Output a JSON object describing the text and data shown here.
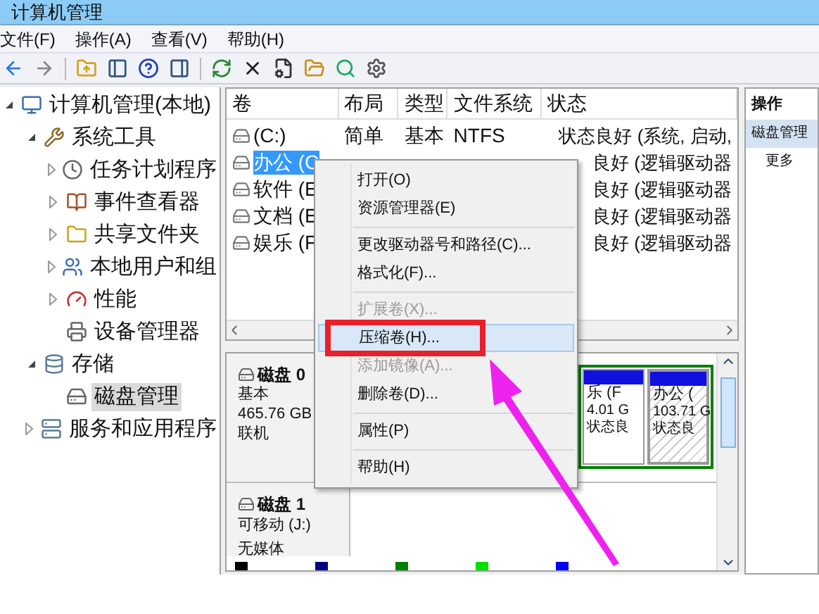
{
  "window": {
    "title": "计算机管理"
  },
  "menu_bar": [
    "文件(F)",
    "操作(A)",
    "查看(V)",
    "帮助(H)"
  ],
  "tree": [
    {
      "label": "计算机管理(本地)",
      "expanded": true,
      "selected": false,
      "children": [
        {
          "label": "系统工具",
          "expanded": true,
          "selected": false,
          "children": [
            {
              "label": "任务计划程序",
              "expanded": false,
              "selected": false
            },
            {
              "label": "事件查看器",
              "expanded": false,
              "selected": false
            },
            {
              "label": "共享文件夹",
              "expanded": false,
              "selected": false
            },
            {
              "label": "本地用户和组",
              "expanded": false,
              "selected": false
            },
            {
              "label": "性能",
              "expanded": false,
              "selected": false
            },
            {
              "label": "设备管理器",
              "selected": false
            }
          ]
        },
        {
          "label": "存储",
          "expanded": true,
          "selected": false,
          "children": [
            {
              "label": "磁盘管理",
              "selected": true
            }
          ]
        },
        {
          "label": "服务和应用程序",
          "expanded": false,
          "selected": false
        }
      ]
    }
  ],
  "volumes": {
    "columns": [
      "卷",
      "布局",
      "类型",
      "文件系统",
      "状态"
    ],
    "rows": [
      {
        "cells": [
          "(C:)",
          "简单",
          "基本",
          "NTFS",
          "状态良好 (系统, 启动,"
        ],
        "selected": false
      },
      {
        "cells": [
          "办公 (C",
          "",
          "",
          "",
          "良好 (逻辑驱动器"
        ],
        "selected": true
      },
      {
        "cells": [
          "软件 (E",
          "",
          "",
          "",
          "良好 (逻辑驱动器"
        ],
        "selected": false
      },
      {
        "cells": [
          "文档 (E",
          "",
          "",
          "",
          "良好 (逻辑驱动器"
        ],
        "selected": false
      },
      {
        "cells": [
          "娱乐 (F",
          "",
          "",
          "",
          "良好 (逻辑驱动器"
        ],
        "selected": false
      }
    ]
  },
  "disks": [
    {
      "name": "磁盘 0",
      "lines": [
        "基本",
        "465.76 GB",
        "联机"
      ],
      "partitions": [
        {
          "name": "乐 (F",
          "size": "4.01 G",
          "status": "状态良",
          "selected": false
        },
        {
          "name": "办公 (",
          "size": "103.71 G",
          "status": "状态良",
          "selected": true
        }
      ]
    },
    {
      "name": "磁盘 1",
      "lines": [
        "可移动 (J:)",
        "无媒体"
      ]
    }
  ],
  "legend": [
    {
      "color": "#000000"
    },
    {
      "color": "#000080"
    },
    {
      "color": "#008000"
    },
    {
      "color": "#00e000"
    },
    {
      "color": "#0000ff"
    }
  ],
  "actions": {
    "title": "操作",
    "items": [
      {
        "label": "磁盘管理",
        "selected": true
      },
      {
        "label": "更多",
        "selected": false
      }
    ]
  },
  "context_menu": [
    {
      "kind": "item",
      "label": "打开(O)",
      "disabled": false,
      "highlighted": false
    },
    {
      "kind": "item",
      "label": "资源管理器(E)",
      "disabled": false,
      "highlighted": false
    },
    {
      "kind": "separator"
    },
    {
      "kind": "item",
      "label": "更改驱动器号和路径(C)...",
      "disabled": false,
      "highlighted": false
    },
    {
      "kind": "item",
      "label": "格式化(F)...",
      "disabled": false,
      "highlighted": false
    },
    {
      "kind": "separator"
    },
    {
      "kind": "item",
      "label": "扩展卷(X)...",
      "disabled": true,
      "highlighted": false
    },
    {
      "kind": "item",
      "label": "压缩卷(H)...",
      "disabled": false,
      "highlighted": true
    },
    {
      "kind": "item",
      "label": "添加镜像(A)...",
      "disabled": true,
      "highlighted": false
    },
    {
      "kind": "item",
      "label": "删除卷(D)...",
      "disabled": false,
      "highlighted": false
    },
    {
      "kind": "separator"
    },
    {
      "kind": "item",
      "label": "属性(P)",
      "disabled": false,
      "highlighted": false
    },
    {
      "kind": "separator"
    },
    {
      "kind": "item",
      "label": "帮助(H)",
      "disabled": false,
      "highlighted": false
    }
  ]
}
